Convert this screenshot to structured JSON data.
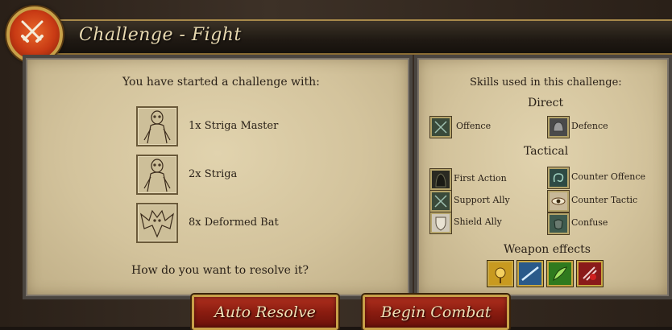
{
  "window": {
    "title": "Challenge - Fight"
  },
  "left_panel": {
    "intro": "You have started a challenge with:",
    "enemies": [
      {
        "label": "1x Striga Master",
        "icon": "striga-master-portrait"
      },
      {
        "label": "2x Striga",
        "icon": "striga-portrait"
      },
      {
        "label": "8x Deformed Bat",
        "icon": "deformed-bat-portrait"
      }
    ],
    "question": "How do you want to resolve it?"
  },
  "right_panel": {
    "heading": "Skills used in this challenge:",
    "direct_heading": "Direct",
    "direct": [
      {
        "label": "Offence",
        "icon": "crossed-swords-icon"
      },
      {
        "label": "Defence",
        "icon": "helmet-icon"
      }
    ],
    "tactical_heading": "Tactical",
    "tactical": [
      {
        "label": "First Action",
        "icon": "hooded-figure-icon"
      },
      {
        "label": "Counter Offence",
        "icon": "serpent-icon"
      },
      {
        "label": "Support Ally",
        "icon": "crossed-swords-icon"
      },
      {
        "label": "Counter Tactic",
        "icon": "eye-icon"
      },
      {
        "label": "Shield Ally",
        "icon": "shield-icon"
      },
      {
        "label": "Confuse",
        "icon": "mask-icon"
      }
    ],
    "weapon_heading": "Weapon effects",
    "weapons": [
      {
        "icon": "gold-effect-icon",
        "color": "#c89a20"
      },
      {
        "icon": "blue-slash-icon",
        "color": "#2a5a8a"
      },
      {
        "icon": "green-effect-icon",
        "color": "#2f7a1e"
      },
      {
        "icon": "red-effect-icon",
        "color": "#8a1a1a"
      }
    ]
  },
  "buttons": {
    "auto_resolve": "Auto Resolve",
    "begin_combat": "Begin Combat"
  }
}
